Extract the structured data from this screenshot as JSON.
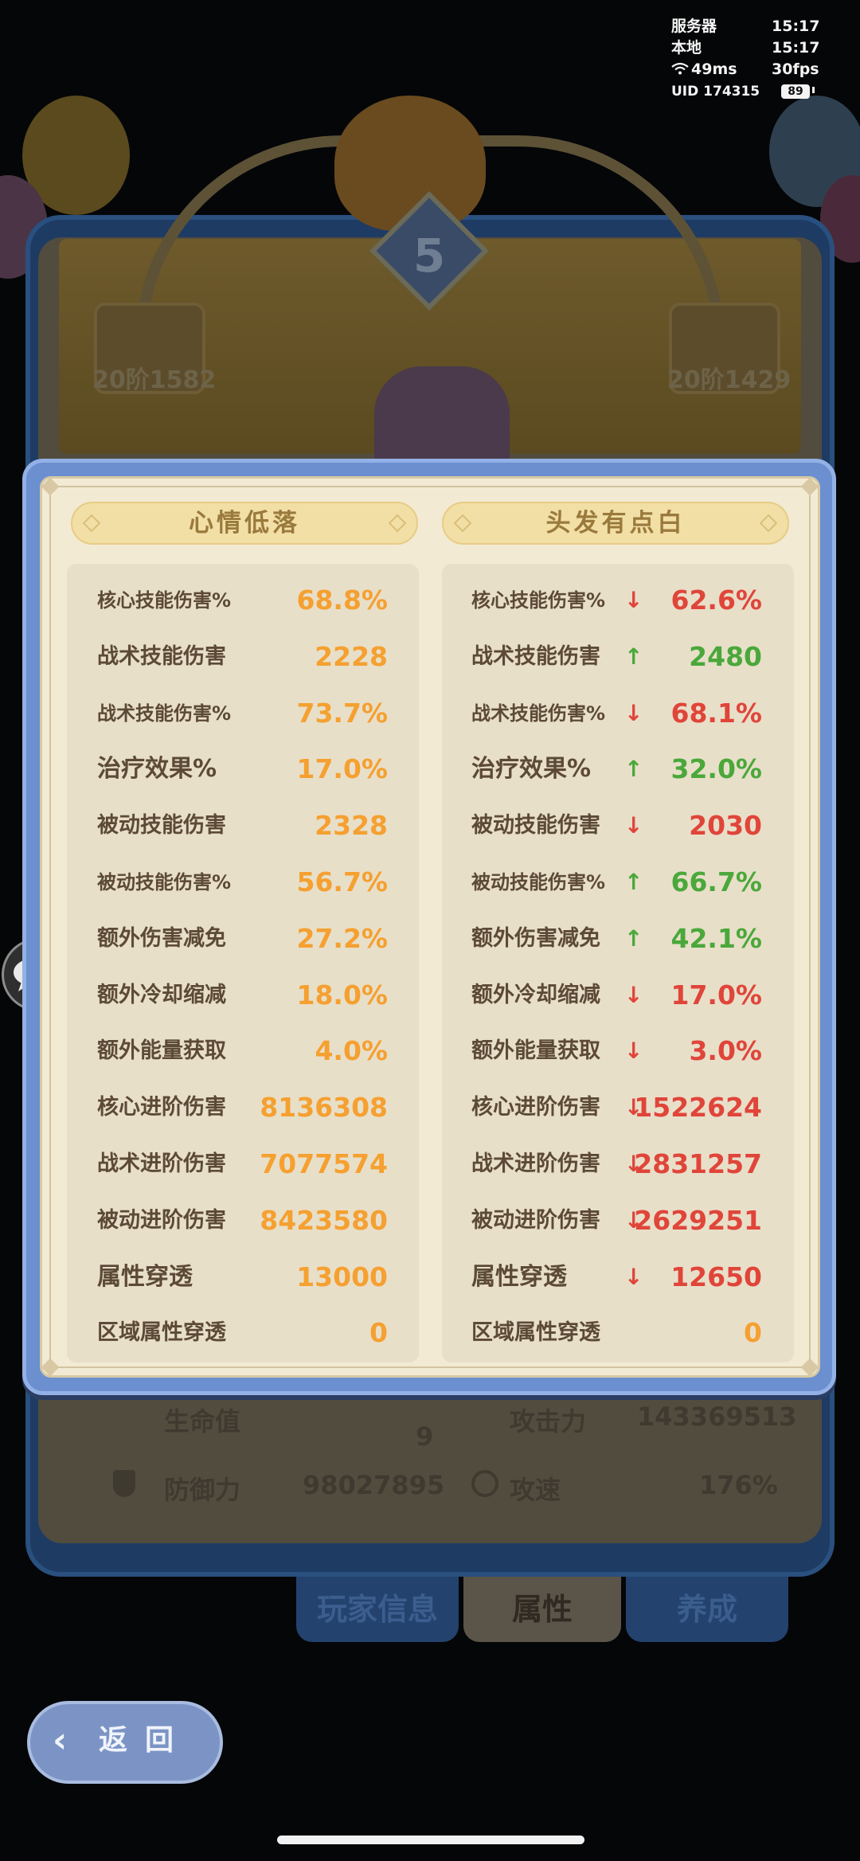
{
  "status": {
    "server_label": "服务器",
    "server_time": "15:17",
    "local_label": "本地",
    "local_time": "15:17",
    "ping": "49ms",
    "fps": "30fps",
    "uid": "UID 174315",
    "battery": "89"
  },
  "background": {
    "level": "5",
    "left_badge": "20阶1582",
    "right_badge": "20阶1429",
    "stats": {
      "hp_label": "生命值",
      "hp_value": "9",
      "atk_label": "攻击力",
      "atk_value": "143369513",
      "def_label": "防御力",
      "def_value": "98027895",
      "spd_label": "攻速",
      "spd_value": "176%"
    },
    "tabs": [
      "玩家信息",
      "属性",
      "养成"
    ],
    "back_label": "返回"
  },
  "colors": {
    "left_value": "#f5a030",
    "up": "#4aa83a",
    "down": "#e0453a"
  },
  "compare": {
    "left": {
      "name": "心情低落",
      "rows": [
        {
          "label": "核心技能伤害%",
          "value": "68.8%"
        },
        {
          "label": "战术技能伤害",
          "value": "2228"
        },
        {
          "label": "战术技能伤害%",
          "value": "73.7%"
        },
        {
          "label": "治疗效果%",
          "value": "17.0%"
        },
        {
          "label": "被动技能伤害",
          "value": "2328"
        },
        {
          "label": "被动技能伤害%",
          "value": "56.7%"
        },
        {
          "label": "额外伤害减免",
          "value": "27.2%"
        },
        {
          "label": "额外冷却缩减",
          "value": "18.0%"
        },
        {
          "label": "额外能量获取",
          "value": "4.0%"
        },
        {
          "label": "核心进阶伤害",
          "value": "8136308"
        },
        {
          "label": "战术进阶伤害",
          "value": "7077574"
        },
        {
          "label": "被动进阶伤害",
          "value": "8423580"
        },
        {
          "label": "属性穿透",
          "value": "13000"
        },
        {
          "label": "区域属性穿透",
          "value": "0"
        }
      ]
    },
    "right": {
      "name": "头发有点白",
      "rows": [
        {
          "label": "核心技能伤害%",
          "value": "62.6%",
          "trend": "down"
        },
        {
          "label": "战术技能伤害",
          "value": "2480",
          "trend": "up"
        },
        {
          "label": "战术技能伤害%",
          "value": "68.1%",
          "trend": "down"
        },
        {
          "label": "治疗效果%",
          "value": "32.0%",
          "trend": "up"
        },
        {
          "label": "被动技能伤害",
          "value": "2030",
          "trend": "down"
        },
        {
          "label": "被动技能伤害%",
          "value": "66.7%",
          "trend": "up"
        },
        {
          "label": "额外伤害减免",
          "value": "42.1%",
          "trend": "up"
        },
        {
          "label": "额外冷却缩减",
          "value": "17.0%",
          "trend": "down"
        },
        {
          "label": "额外能量获取",
          "value": "3.0%",
          "trend": "down"
        },
        {
          "label": "核心进阶伤害",
          "value": "1522624",
          "trend": "down"
        },
        {
          "label": "战术进阶伤害",
          "value": "2831257",
          "trend": "down"
        },
        {
          "label": "被动进阶伤害",
          "value": "2629251",
          "trend": "down"
        },
        {
          "label": "属性穿透",
          "value": "12650",
          "trend": "down"
        },
        {
          "label": "区域属性穿透",
          "value": "0",
          "trend": "none"
        }
      ]
    }
  }
}
